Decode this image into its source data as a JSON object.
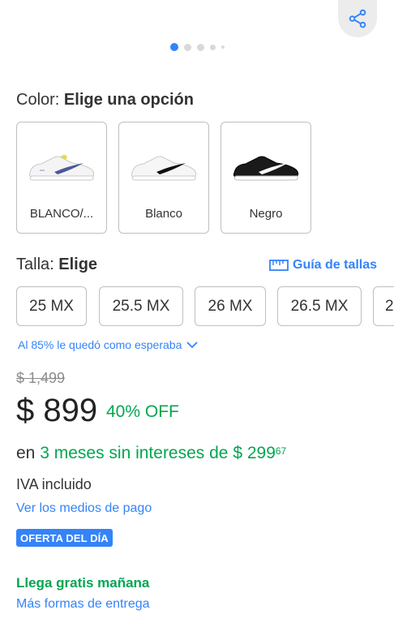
{
  "colors": {
    "accent": "#3483fa",
    "green": "#00a650",
    "selected_dot": "#3483fa"
  },
  "share": {
    "icon": "share-icon"
  },
  "gallery": {
    "page_count": 5,
    "current_page": 1
  },
  "color_selector": {
    "label": "Color:",
    "value": "Elige una opción",
    "options": [
      {
        "name": "BLANCO/...",
        "shoe": "white-sneaker-blue-swoosh"
      },
      {
        "name": "Blanco",
        "shoe": "white-sneaker-black-swoosh"
      },
      {
        "name": "Negro",
        "shoe": "black-sneaker-white-swoosh"
      }
    ]
  },
  "size_selector": {
    "label": "Talla:",
    "value": "Elige",
    "guide_label": "Guía de tallas",
    "guide_icon": "ruler-icon",
    "options": [
      "25 MX",
      "25.5 MX",
      "26 MX",
      "26.5 MX",
      "2"
    ]
  },
  "fit": {
    "text": "Al 85% le quedó como esperaba",
    "icon": "chevron-down-icon"
  },
  "pricing": {
    "original_price": "$ 1,499",
    "price": "$ 899",
    "discount": "40% OFF",
    "installments_prefix": "en",
    "installments_text": "3 meses sin intereses de $ 299",
    "installments_cents": "67",
    "tax_note": "IVA incluido",
    "payment_link": "Ver los medios de pago",
    "deal_badge": "OFERTA DEL DÍA"
  },
  "shipping": {
    "headline": "Llega gratis mañana",
    "more_options_link": "Más formas de entrega"
  }
}
